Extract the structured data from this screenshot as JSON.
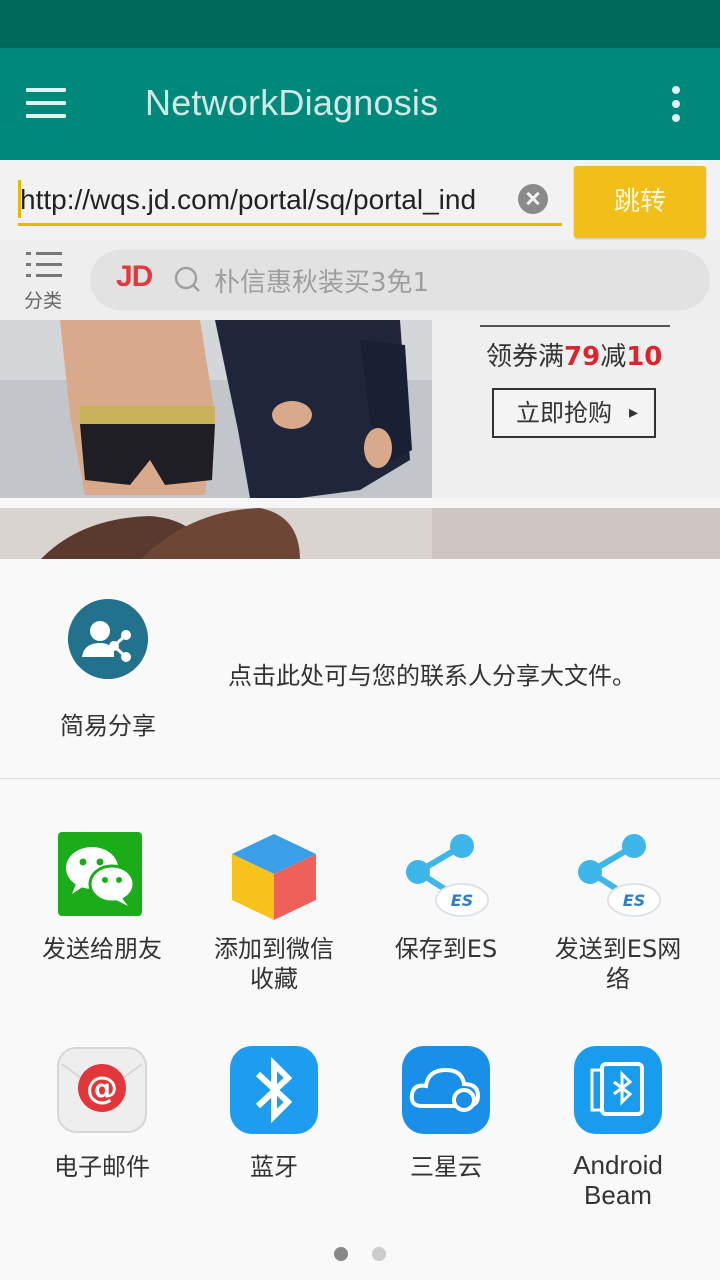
{
  "app_bar": {
    "title": "NetworkDiagnosis"
  },
  "url_bar": {
    "value": "http://wqs.jd.com/portal/sq/portal_ind",
    "go_label": "跳转"
  },
  "jd": {
    "category_label": "分类",
    "logo": "JD",
    "search_placeholder": "朴信惠秋装买3免1",
    "promo_prefix": "领券满",
    "promo_num1": "79",
    "promo_mid": "减",
    "promo_num2": "10",
    "promo_button": "立即抢购"
  },
  "share": {
    "easy_share_label": "简易分享",
    "easy_share_desc": "点击此处可与您的联系人分享大文件。",
    "apps": [
      {
        "label": "发送给朋友",
        "icon": "wechat-icon"
      },
      {
        "label": "添加到微信收藏",
        "icon": "wechat-favorites-cube-icon"
      },
      {
        "label": "保存到ES",
        "icon": "es-share-icon"
      },
      {
        "label": "发送到ES网络",
        "icon": "es-network-share-icon"
      },
      {
        "label": "电子邮件",
        "icon": "email-icon"
      },
      {
        "label": "蓝牙",
        "icon": "bluetooth-icon"
      },
      {
        "label": "三星云",
        "icon": "samsung-cloud-icon"
      },
      {
        "label": "Android Beam",
        "icon": "android-beam-icon"
      }
    ]
  },
  "colors": {
    "status_bar": "#00695c",
    "app_bar": "#00897b",
    "go_button": "#f2bf1a",
    "jd_red": "#e4393c"
  },
  "pager": {
    "active_dot_color": "#888888",
    "inactive_dot_color": "#cccccc"
  }
}
